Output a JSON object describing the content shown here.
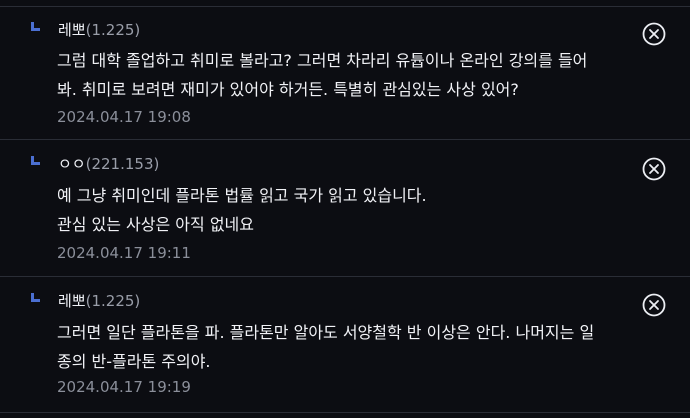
{
  "comments": [
    {
      "author": "레뽀",
      "ip": "(1.225)",
      "lines": [
        "그럼 대학 졸업하고 취미로 볼라고? 그러면 차라리 유튭이나 온라인 강의를 들어",
        "봐. 취미로 보려면 재미가 있어야 하거든. 특별히 관심있는 사상 있어?"
      ],
      "timestamp": "2024.04.17 19:08"
    },
    {
      "author": "ㅇㅇ",
      "ip": "(221.153)",
      "lines": [
        "예 그냥 취미인데 플라톤 법률 읽고 국가 읽고 있습니다.",
        "관심 있는 사상은 아직 없네요"
      ],
      "timestamp": "2024.04.17 19:11"
    },
    {
      "author": "레뽀",
      "ip": "(1.225)",
      "lines": [
        "그러면 일단 플라톤을 파. 플라톤만 알아도 서양철학 반 이상은 안다. 나머지는 일",
        "종의 반-플라톤 주의야."
      ],
      "timestamp": "2024.04.17 19:19"
    }
  ],
  "icons": {
    "reply": "reply-arrow-icon",
    "delete": "close-circle-icon"
  },
  "colors": {
    "background": "#0c0d12",
    "divider": "#2a2d36",
    "reply_accent": "#4b6fd1",
    "text": "#f1f2f6",
    "muted_text": "#8b8f9a"
  }
}
